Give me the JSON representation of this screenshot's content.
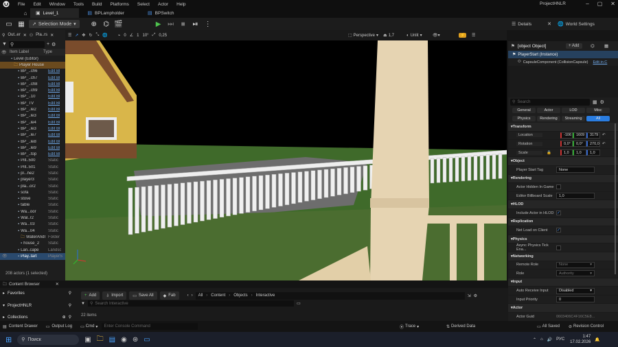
{
  "menu": [
    "File",
    "Edit",
    "Window",
    "Tools",
    "Build",
    "Platforms",
    "Select",
    "Actor",
    "Help"
  ],
  "project_name": "ProjectHNLR",
  "doc_tabs": [
    "Level_1",
    "BPLampholder",
    "BPSwitch"
  ],
  "toolbar": {
    "mode": "Selection Mode"
  },
  "viewport": {
    "perspective": "Perspective",
    "lit": "Unlit",
    "grid_snap": "0",
    "angle": "10°",
    "scale": "0,25",
    "fov": "1",
    "speed": "1,7"
  },
  "outliner": {
    "tabs": [
      "Out..er",
      "Pla..rs"
    ],
    "col_label": "Item Label",
    "col_type": "Type",
    "rows": [
      {
        "label": "Level (Editor)",
        "type": ""
      },
      {
        "label": "Player House",
        "type": ""
      },
      {
        "label": "BP_..ch6",
        "type": "Edit Bl"
      },
      {
        "label": "BP_..ch7",
        "type": "Edit Bl"
      },
      {
        "label": "BP_..ch8",
        "type": "Edit Bl"
      },
      {
        "label": "BP_..ch9",
        "type": "Edit Bl"
      },
      {
        "label": "BP_..10",
        "type": "Edit Bl"
      },
      {
        "label": "BP_TV",
        "type": "Edit Bl"
      },
      {
        "label": "BP_..le2",
        "type": "Edit Bl"
      },
      {
        "label": "BP_..le3",
        "type": "Edit Bl"
      },
      {
        "label": "BP_..le4",
        "type": "Edit Bl"
      },
      {
        "label": "BP_..le3",
        "type": "Edit Bl"
      },
      {
        "label": "BP_..le7",
        "type": "Edit Bl"
      },
      {
        "label": "BP_..le8",
        "type": "Edit Bl"
      },
      {
        "label": "BP_..le9",
        "type": "Edit Bl"
      },
      {
        "label": "BP_..top",
        "type": "Edit Bl"
      },
      {
        "label": "Pill..500",
        "type": "Static"
      },
      {
        "label": "Pill..501",
        "type": "Static"
      },
      {
        "label": "pl...he2",
        "type": "Static"
      },
      {
        "label": "player3",
        "type": "Static"
      },
      {
        "label": "pla...or2",
        "type": "Static"
      },
      {
        "label": "sofa",
        "type": "Static"
      },
      {
        "label": "stove",
        "type": "Static"
      },
      {
        "label": "table",
        "type": "Static"
      },
      {
        "label": "Wa...oor",
        "type": "Static"
      },
      {
        "label": "Wal..r2",
        "type": "Static"
      },
      {
        "label": "Wa...03",
        "type": "Static"
      },
      {
        "label": "Wa...04",
        "type": "Static"
      },
      {
        "label": "WaterAndI",
        "type": "Folder"
      },
      {
        "label": "house_2",
        "type": "Static"
      },
      {
        "label": "Lan..cape",
        "type": "Landsc"
      },
      {
        "label": "Play..tart",
        "type": "PlayerS"
      }
    ],
    "count": "208 actors (1 selected)"
  },
  "details": {
    "tabs": [
      "Details",
      "World Settings"
    ],
    "actor": {
      "label": "Actor",
      "guid_label": "Actor Guid",
      "guid_value": "0603406C4F16C5E8..."
    },
    "add": "+ Add",
    "instance": "PlayerStart (Instance)",
    "component": "CapsuleComponent (CollisionCapsule)",
    "component_link": "Edit in C",
    "search_placeholder": "Search",
    "filters_row1": [
      "General",
      "Actor",
      "LOD",
      "Misc"
    ],
    "filters_row2": [
      "Physics",
      "Rendering",
      "Streaming",
      "All"
    ],
    "transform": {
      "label": "Transform",
      "location": [
        "-106",
        "1609",
        "3179"
      ],
      "rotation": [
        "0,0°",
        "0,0°",
        "270,0"
      ],
      "scale": [
        "1,0",
        "1,0",
        "1,0"
      ],
      "location_label": "Location",
      "rotation_label": "Rotation",
      "scale_label": "Scale"
    },
    "object": {
      "label": "Object",
      "tag_label": "Player Start Tag",
      "tag_value": "None"
    },
    "rendering": {
      "label": "Rendering",
      "hidden_label": "Actor Hidden In Game",
      "billboard_label": "Editor Billboard Scale",
      "billboard_value": "1,0"
    },
    "hlod": {
      "label": "HLOD",
      "include_label": "Include Actor in HLOD"
    },
    "replication": {
      "label": "Replication",
      "net_label": "Net Load on Client"
    },
    "physics": {
      "label": "Physics",
      "async_label": "Async Physics Tick Ena..."
    },
    "networking": {
      "label": "Networking",
      "remote_label": "Remote Role",
      "remote_value": "None",
      "role_label": "Role",
      "role_value": "Authority"
    },
    "input": {
      "label": "Input",
      "auto_label": "Auto Receive Input",
      "auto_value": "Disabled",
      "priority_label": "Input Priority",
      "priority_value": "0"
    }
  },
  "content_browser": {
    "tab": "Content Browser",
    "add": "Add",
    "import": "Import",
    "save_all": "Save All",
    "fab": "Fab",
    "path": [
      "All",
      "Content",
      "Objects",
      "Interactive"
    ],
    "favorites": "Favorites",
    "project": "ProjectHNLR",
    "collections": "Collections",
    "search_placeholder": "Search Interactive",
    "items": "22 items"
  },
  "statusbar": {
    "drawer": "Content Drawer",
    "output": "Output Log",
    "cmd": "Cmd",
    "console_placeholder": "Enter Console Command",
    "trace": "Trace",
    "derived": "Derived Data",
    "all_saved": "All Saved",
    "revision": "Revision Control"
  },
  "taskbar": {
    "search": "Поиск",
    "lang": "РУС",
    "time": "1:47",
    "date": "17.02.2026"
  }
}
